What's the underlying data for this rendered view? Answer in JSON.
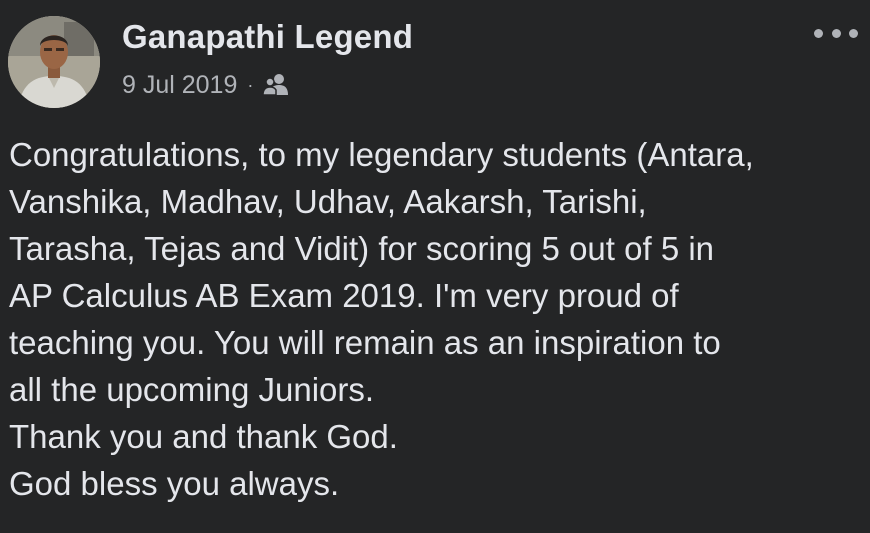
{
  "post": {
    "author": "Ganapathi Legend",
    "date": "9 Jul 2019",
    "separator": "·",
    "audience_icon": "friends-icon",
    "more_icon": "more-options-icon",
    "text_lines": [
      "Congratulations, to my legendary students (Antara,",
      "Vanshika, Madhav, Udhav, Aakarsh, Tarishi,",
      "Tarasha, Tejas and Vidit) for scoring 5 out of 5 in",
      "AP Calculus AB Exam 2019. I'm very proud of",
      "teaching you. You will remain as an inspiration to",
      "all the upcoming Juniors.",
      "Thank you and thank God.",
      "God bless you always."
    ]
  },
  "colors": {
    "background": "#242526",
    "primary_text": "#e4e6eb",
    "secondary_text": "#b0b3b8"
  }
}
